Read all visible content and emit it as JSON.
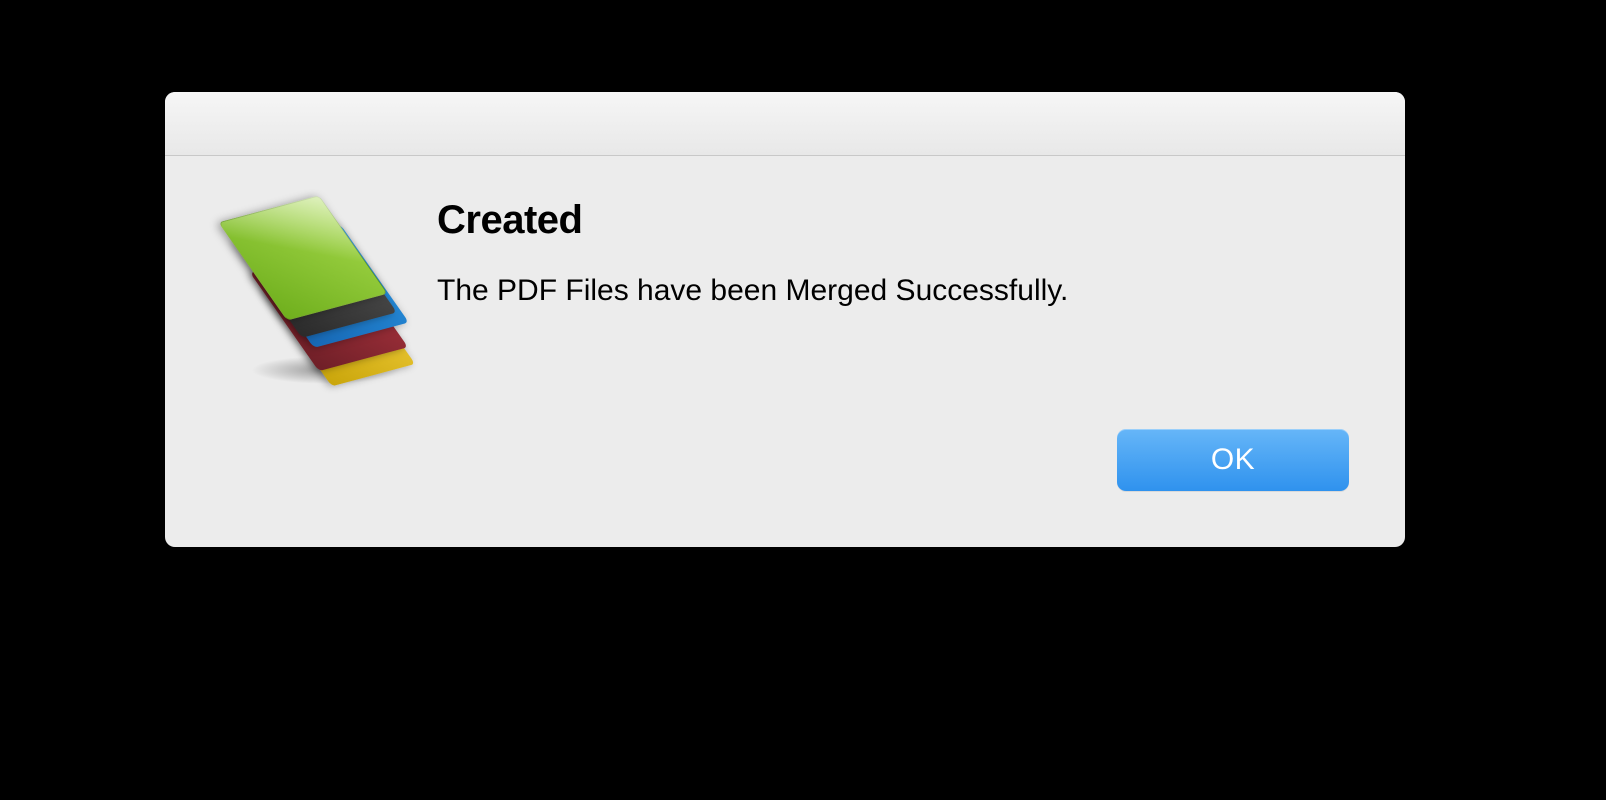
{
  "dialog": {
    "icon": "stacked-books-icon",
    "title": "Created",
    "message": "The PDF Files have been Merged Successfully.",
    "ok_label": "OK"
  }
}
